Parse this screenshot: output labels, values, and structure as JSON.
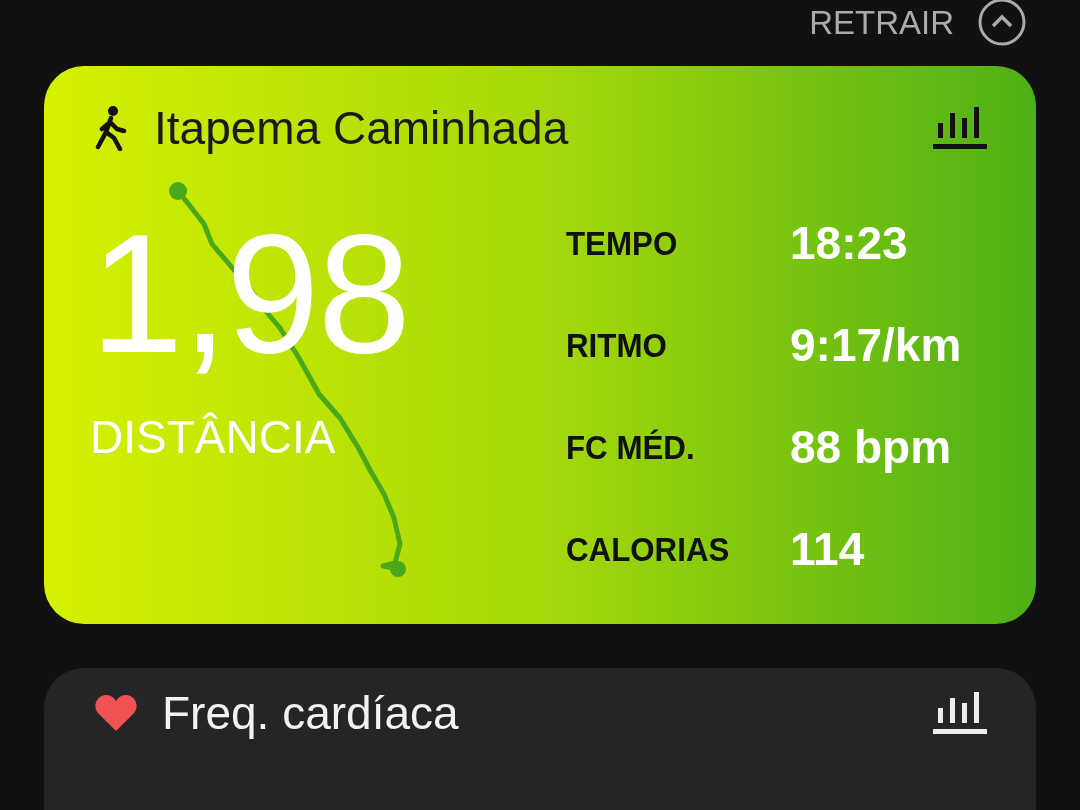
{
  "top_bar": {
    "collapse_label": "RETRAIR"
  },
  "activity_card": {
    "title": "Itapema Caminhada",
    "distance": "1,98",
    "distance_label": "DISTÂNCIA",
    "stats": [
      {
        "label": "TEMPO",
        "value": "18:23"
      },
      {
        "label": "RITMO",
        "value": "9:17/km"
      },
      {
        "label": "FC MÉD.",
        "value": "88 bpm"
      },
      {
        "label": "CALORIAS",
        "value": "114"
      }
    ]
  },
  "heart_rate_card": {
    "title": "Freq. cardíaca"
  }
}
